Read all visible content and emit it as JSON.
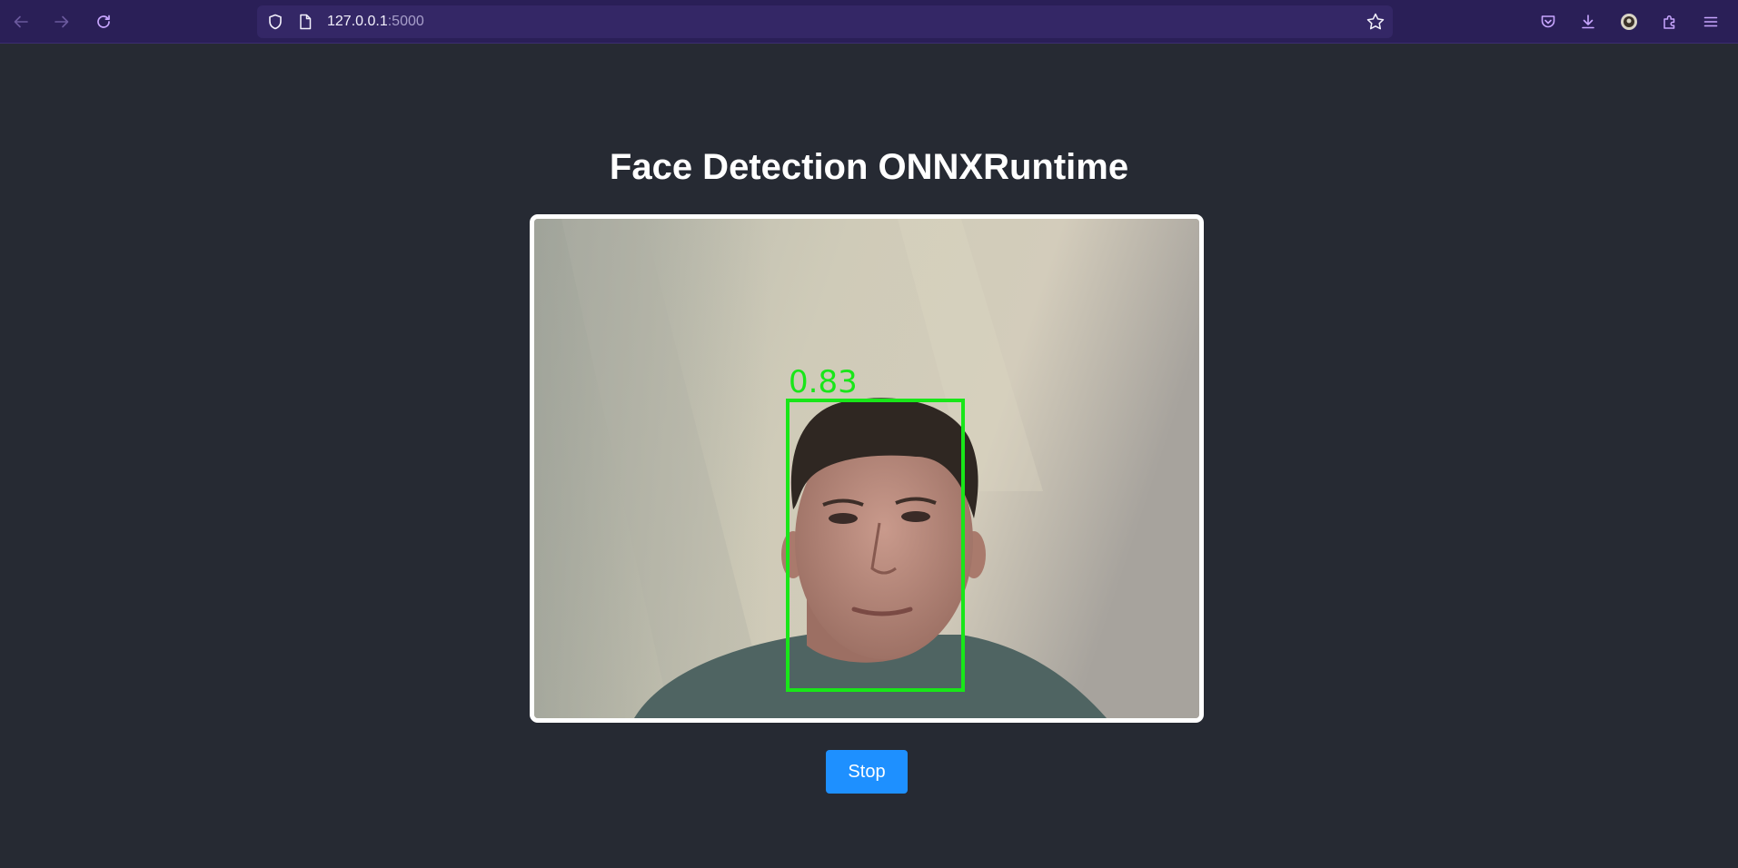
{
  "browser": {
    "url_host": "127.0.0.1",
    "url_port": ":5000",
    "colors": {
      "toolbar": "#2a1f57",
      "urlbar": "#342766",
      "icon_accent": "#c8a6ff"
    },
    "icons": [
      "back-arrow-icon",
      "forward-arrow-icon",
      "reload-icon",
      "shield-icon",
      "page-icon",
      "bookmark-star-icon",
      "pocket-icon",
      "download-icon",
      "account-avatar-icon",
      "extensions-icon",
      "menu-icon"
    ]
  },
  "page": {
    "title": "Face Detection ONNXRuntime",
    "background": "#262a33"
  },
  "detection": {
    "score_label": "0.83",
    "box_color": "#19e619"
  },
  "controls": {
    "stop_label": "Stop",
    "stop_color": "#1e90ff"
  }
}
